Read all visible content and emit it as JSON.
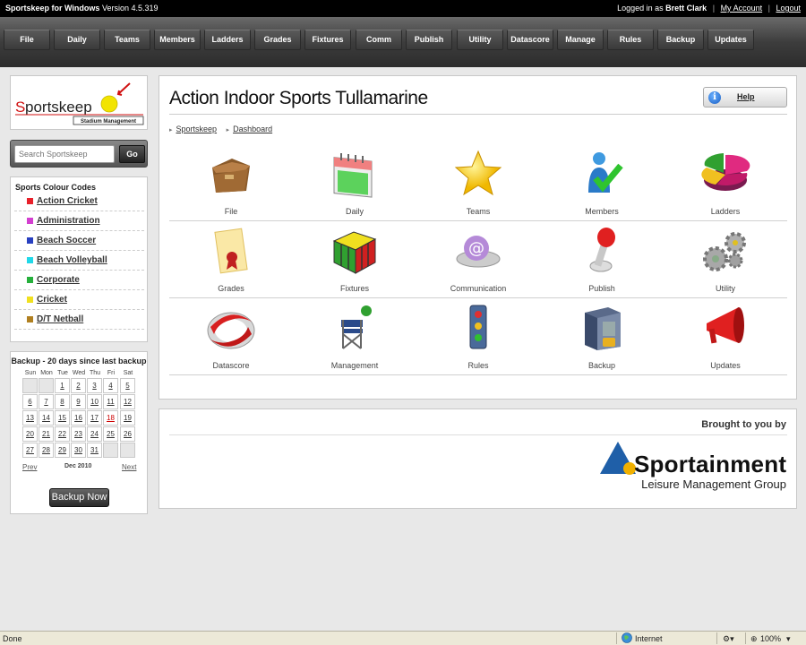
{
  "titlebar": {
    "app_name": "Sportskeep for Windows",
    "version": "Version 4.5.319",
    "logged_in_prefix": "Logged in as",
    "user": "Brett Clark",
    "my_account": "My Account",
    "logout": "Logout"
  },
  "nav": [
    "File",
    "Daily",
    "Teams",
    "Members",
    "Ladders",
    "Grades",
    "Fixtures",
    "Comm",
    "Publish",
    "Utility",
    "Datascore",
    "Manage",
    "Rules",
    "Backup",
    "Updates"
  ],
  "logo": {
    "word": "Sportskeep",
    "initial": "S",
    "rest": "portskeep",
    "tagline": "Stadium Management"
  },
  "search": {
    "placeholder": "Search Sportskeep",
    "go_label": "Go"
  },
  "sports": {
    "title": "Sports Colour Codes",
    "items": [
      {
        "label": "Action Cricket",
        "color": "#e8202a"
      },
      {
        "label": "Administration",
        "color": "#d33fd0"
      },
      {
        "label": "Beach Soccer",
        "color": "#2840c0"
      },
      {
        "label": "Beach Volleyball",
        "color": "#20d8e8"
      },
      {
        "label": "Corporate",
        "color": "#26b03c"
      },
      {
        "label": "Cricket",
        "color": "#f0e020"
      },
      {
        "label": "D/T Netball",
        "color": "#b08020"
      }
    ]
  },
  "backup": {
    "title": "Backup - 20 days since last backup",
    "days_of_week": [
      "Sun",
      "Mon",
      "Tue",
      "Wed",
      "Thu",
      "Fri",
      "Sat"
    ],
    "weeks": [
      [
        "",
        "",
        "1",
        "2",
        "3",
        "4",
        "5"
      ],
      [
        "6",
        "7",
        "8",
        "9",
        "10",
        "11",
        "12"
      ],
      [
        "13",
        "14",
        "15",
        "16",
        "17",
        "18",
        "19"
      ],
      [
        "20",
        "21",
        "22",
        "23",
        "24",
        "25",
        "26"
      ],
      [
        "27",
        "28",
        "29",
        "30",
        "31",
        "",
        ""
      ]
    ],
    "today": "18",
    "prev": "Prev",
    "month": "Dec 2010",
    "next": "Next",
    "button": "Backup Now"
  },
  "main": {
    "title": "Action Indoor Sports Tullamarine",
    "help": "Help",
    "breadcrumb": [
      "Sportskeep",
      "Dashboard"
    ],
    "tiles": [
      {
        "label": "File",
        "icon": "folder-icon"
      },
      {
        "label": "Daily",
        "icon": "calendar-icon"
      },
      {
        "label": "Teams",
        "icon": "star-icon"
      },
      {
        "label": "Members",
        "icon": "member-icon"
      },
      {
        "label": "Ladders",
        "icon": "pie-chart-icon"
      },
      {
        "label": "Grades",
        "icon": "certificate-icon"
      },
      {
        "label": "Fixtures",
        "icon": "cube-icon"
      },
      {
        "label": "Communication",
        "icon": "email-icon"
      },
      {
        "label": "Publish",
        "icon": "joystick-icon"
      },
      {
        "label": "Utility",
        "icon": "gears-icon"
      },
      {
        "label": "Datascore",
        "icon": "datascore-icon"
      },
      {
        "label": "Management",
        "icon": "director-chair-icon"
      },
      {
        "label": "Rules",
        "icon": "traffic-light-icon"
      },
      {
        "label": "Backup",
        "icon": "safe-icon"
      },
      {
        "label": "Updates",
        "icon": "megaphone-icon"
      }
    ]
  },
  "sponsor": {
    "brought_by": "Brought to you by",
    "name": "Sportainment",
    "sub": "Leisure Management Group"
  },
  "statusbar": {
    "status": "Done",
    "zone": "Internet",
    "zoom": "100%"
  }
}
